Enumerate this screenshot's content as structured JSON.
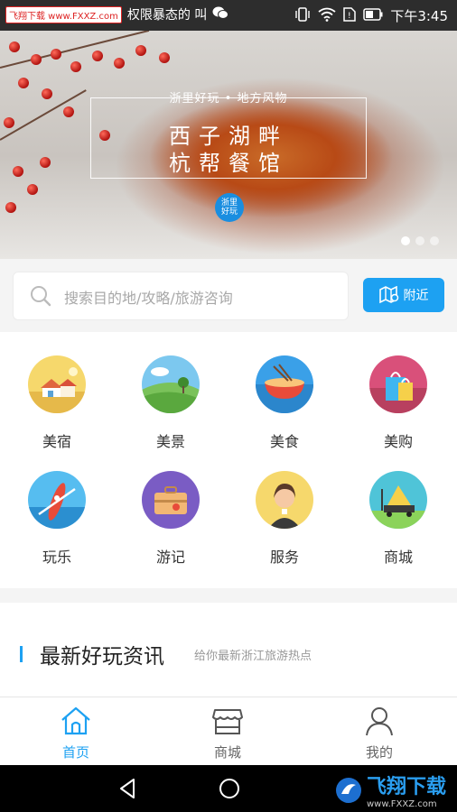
{
  "status_bar": {
    "left_text": "权限暴态的 叫",
    "watermark": "飞翔下载 www.FXXZ.com",
    "time": "下午3:45"
  },
  "banner": {
    "tagline": "浙里好玩 • 地方风物",
    "title_line1": "西子湖畔",
    "title_line2": "杭帮餐馆",
    "seal_text": "浙里好玩",
    "page_count": 3,
    "active_page": 1
  },
  "search": {
    "placeholder": "搜索目的地/攻略/旅游咨询",
    "nearby_label": "附近"
  },
  "categories": [
    {
      "label": "美宿",
      "icon": "homestay-icon",
      "color": "#f3d36a"
    },
    {
      "label": "美景",
      "icon": "scenery-icon",
      "color": "#8ed46a"
    },
    {
      "label": "美食",
      "icon": "food-icon",
      "color": "#3aa0e8"
    },
    {
      "label": "美购",
      "icon": "shopping-icon",
      "color": "#d9507a"
    },
    {
      "label": "玩乐",
      "icon": "kayak-icon",
      "color": "#56bdf0"
    },
    {
      "label": "游记",
      "icon": "suitcase-icon",
      "color": "#7a5cc4"
    },
    {
      "label": "服务",
      "icon": "service-icon",
      "color": "#f6d86c"
    },
    {
      "label": "商城",
      "icon": "mall-icon",
      "color": "#4fc4d8"
    }
  ],
  "news": {
    "title": "最新好玩资讯",
    "subtitle": "给你最新浙江旅游热点"
  },
  "tabs": [
    {
      "label": "首页",
      "icon": "home-icon",
      "active": true
    },
    {
      "label": "商城",
      "icon": "store-icon",
      "active": false
    },
    {
      "label": "我的",
      "icon": "profile-icon",
      "active": false
    }
  ],
  "nav_watermark": {
    "title": "飞翔下载",
    "url": "www.FXXZ.com"
  },
  "colors": {
    "accent": "#1da1f2"
  }
}
